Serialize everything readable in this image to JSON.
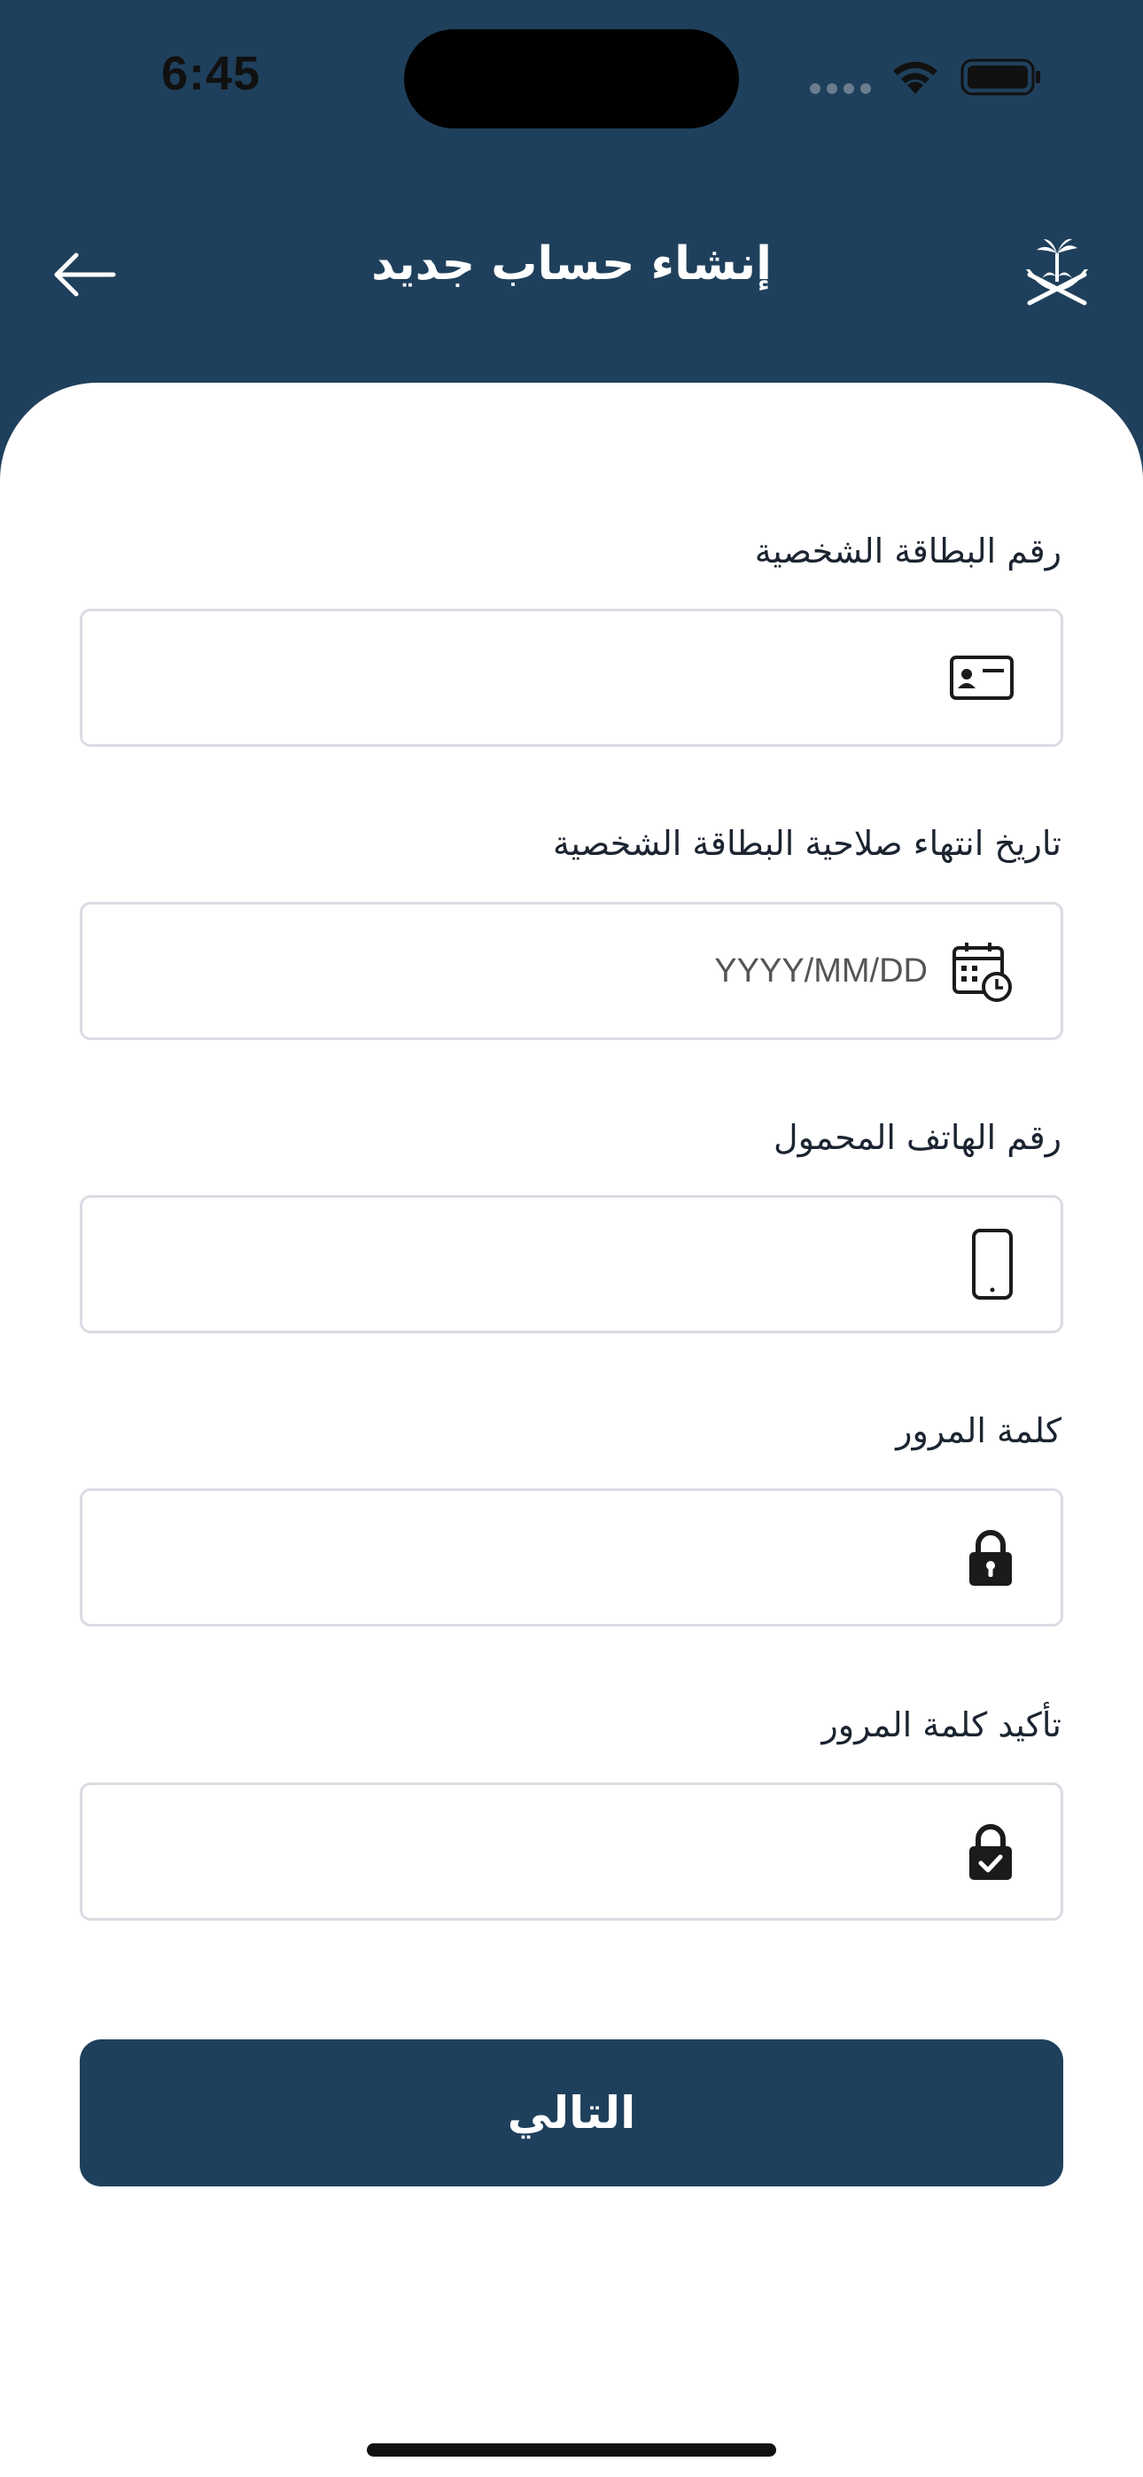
{
  "status_bar": {
    "time": "6:45"
  },
  "header": {
    "title": "إنشاء حساب جديد"
  },
  "form": {
    "fields": [
      {
        "label": "رقم البطاقة الشخصية",
        "placeholder": "",
        "icon": "id-card-icon"
      },
      {
        "label": "تاريخ انتهاء صلاحية البطاقة الشخصية",
        "placeholder": "YYYY/MM/DD",
        "icon": "calendar-clock-icon"
      },
      {
        "label": "رقم الهاتف المحمول",
        "placeholder": "",
        "icon": "mobile-phone-icon"
      },
      {
        "label": "كلمة المرور",
        "placeholder": "",
        "icon": "lock-icon"
      },
      {
        "label": "تأكيد كلمة المرور",
        "placeholder": "",
        "icon": "lock-check-icon"
      }
    ],
    "next_label": "التالي"
  },
  "colors": {
    "primary": "#1f405c",
    "background": "#ffffff",
    "border": "#d9dde2"
  }
}
